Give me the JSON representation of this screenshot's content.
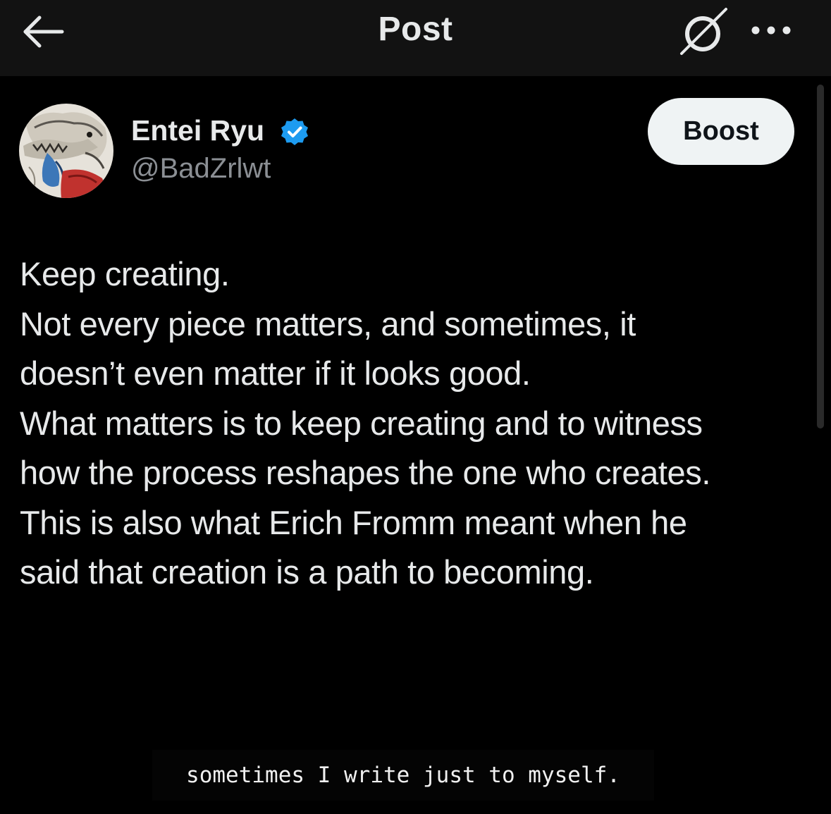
{
  "header": {
    "title": "Post",
    "back_icon": "arrow-left-icon",
    "grok_icon": "grok-slash-icon",
    "more_icon": "more-horizontal-icon"
  },
  "author": {
    "display_name": "Entei Ryu",
    "handle": "@BadZrlwt",
    "verified": true,
    "verified_color": "#1d9bf0",
    "avatar_icon": "illustrated-creature-avatar"
  },
  "actions": {
    "boost_label": "Boost"
  },
  "post": {
    "lines": [
      "Keep creating.",
      "Not every piece matters, and sometimes, it",
      "doesn’t even matter if it looks good.",
      "What matters is to keep creating and to witness",
      "how the process reshapes the one who creates.",
      "This is also what Erich Fromm meant when he",
      "said that creation is a path to becoming."
    ]
  },
  "caption": {
    "text": "sometimes I write just to myself."
  },
  "colors": {
    "background": "#000000",
    "header_background": "#121212",
    "primary_text": "#e7e9ea",
    "secondary_text": "#8b8f94",
    "boost_background": "#eff3f4"
  }
}
